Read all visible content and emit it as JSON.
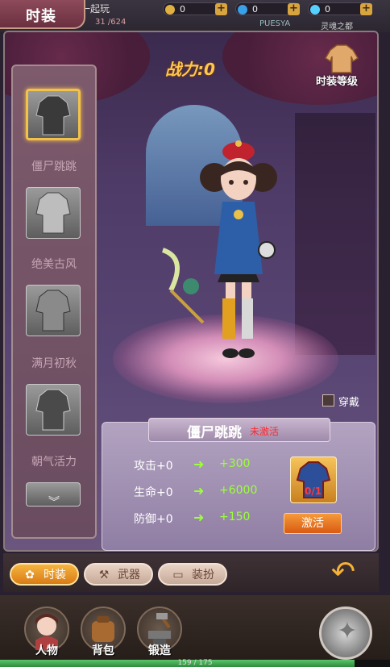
{
  "header": {
    "title": "时装",
    "partial_text_1": "一起玩",
    "partial_text_2": "31 /624",
    "partial_text_3": "PUESYA",
    "partial_text_4": "灵魂之都",
    "currencies": [
      {
        "name": "gold-coin-icon",
        "value": "0",
        "color": "#e0b040"
      },
      {
        "name": "blue-gem-icon",
        "value": "0",
        "color": "#3aa0e8"
      },
      {
        "name": "diamond-icon",
        "value": "0",
        "color": "#55d0ff"
      }
    ],
    "plus": "+"
  },
  "power": {
    "text": "战力:0"
  },
  "outfit_level": {
    "label": "时装等级"
  },
  "outfit_list": [
    {
      "label": "僵尸跳跳",
      "selected": true
    },
    {
      "label": "绝美古风",
      "selected": false
    },
    {
      "label": "满月初秋",
      "selected": false
    },
    {
      "label": "朝气活力",
      "selected": false
    }
  ],
  "wear": {
    "label": "穿戴"
  },
  "detail": {
    "name": "僵尸跳跳",
    "status": "未激活",
    "stats": [
      {
        "name": "攻击+0",
        "arrow": "➜",
        "bonus": "+300"
      },
      {
        "name": "生命+0",
        "arrow": "➜",
        "bonus": "+6000"
      },
      {
        "name": "防御+0",
        "arrow": "➜",
        "bonus": "+150"
      }
    ],
    "reward_count": "0/1",
    "activate_label": "激活"
  },
  "tabs": [
    {
      "label": "时装",
      "icon": "✿",
      "active": true
    },
    {
      "label": "武器",
      "icon": "⚒",
      "active": false
    },
    {
      "label": "装扮",
      "icon": "▭",
      "active": false
    }
  ],
  "dock": [
    {
      "label": "人物"
    },
    {
      "label": "背包"
    },
    {
      "label": "锻造"
    }
  ],
  "exp": {
    "text": "159 / 175",
    "ratio": 0.9086
  }
}
